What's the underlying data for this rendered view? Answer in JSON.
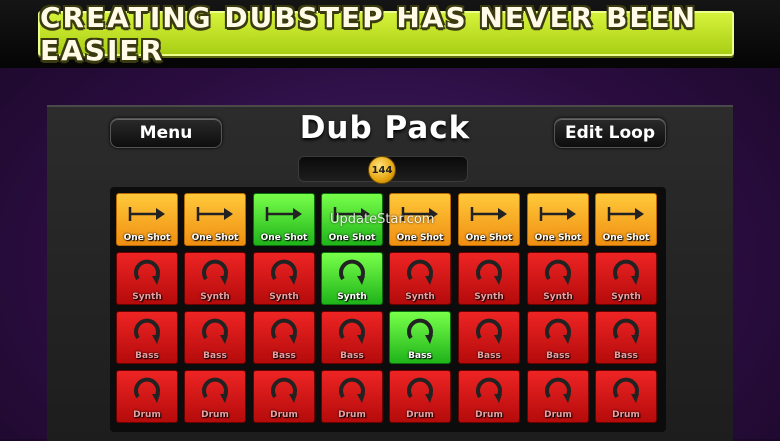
{
  "banner": {
    "text": "CREATING DUBSTEP HAS NEVER BEEN EASIER"
  },
  "header": {
    "menu_label": "Menu",
    "title": "Dub Pack",
    "edit_loop_label": "Edit Loop"
  },
  "tempo": {
    "value": "144"
  },
  "watermark": "UpdateStar.com",
  "colors": {
    "orange": "#f5a623",
    "green": "#3ed12a",
    "red": "#d91515",
    "banner": "#c5e62a"
  },
  "pad_rows": [
    {
      "label": "One Shot",
      "icon": "arrow-right-icon",
      "states": [
        "orange",
        "orange",
        "green",
        "green",
        "orange",
        "orange",
        "orange",
        "orange"
      ]
    },
    {
      "label": "Synth",
      "icon": "loop-icon",
      "states": [
        "red",
        "red",
        "red",
        "green",
        "red",
        "red",
        "red",
        "red"
      ]
    },
    {
      "label": "Bass",
      "icon": "loop-icon",
      "states": [
        "red",
        "red",
        "red",
        "red",
        "green",
        "red",
        "red",
        "red"
      ]
    },
    {
      "label": "Drum",
      "icon": "loop-icon",
      "states": [
        "red",
        "red",
        "red",
        "red",
        "red",
        "red",
        "red",
        "red"
      ]
    }
  ]
}
